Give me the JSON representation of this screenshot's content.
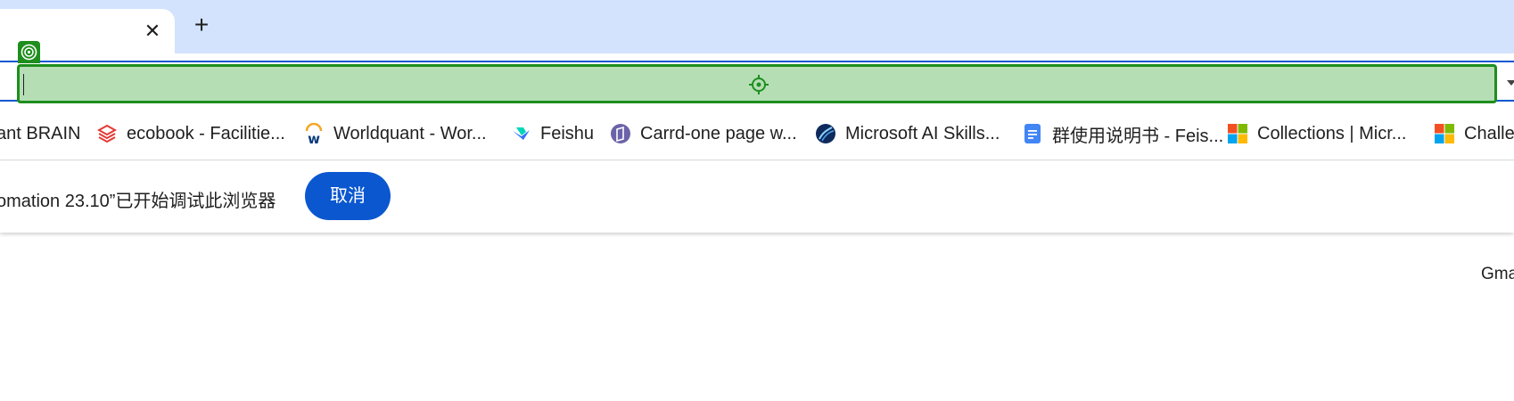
{
  "tabs": {
    "active_title": "",
    "close_glyph": "✕",
    "new_tab_glyph": "+"
  },
  "omnibox": {
    "value": "",
    "highlight_color": "#b5deb5",
    "highlight_border": "#1e8e1e",
    "focus_ring_color": "#0b57d0",
    "target_icon": "crosshair-icon",
    "marker_icon": "target-icon"
  },
  "bookmarks": [
    {
      "label": "ant BRAIN",
      "icon": "none"
    },
    {
      "label": "ecobook - Facilitie...",
      "icon": "ecobook-icon"
    },
    {
      "label": "Worldquant - Wor...",
      "icon": "workday-icon"
    },
    {
      "label": "Feishu",
      "icon": "feishu-icon"
    },
    {
      "label": "Carrd-one page w...",
      "icon": "carrd-icon"
    },
    {
      "label": "Microsoft AI Skills...",
      "icon": "globe-icon"
    },
    {
      "label": "群使用说明书 - Feis...",
      "icon": "docs-icon"
    },
    {
      "label": "Collections | Micr...",
      "icon": "microsoft-icon"
    },
    {
      "label": "Challe",
      "icon": "microsoft-icon"
    }
  ],
  "infobar": {
    "message": "omation 23.10”已开始调试此浏览器",
    "cancel_label": "取消"
  },
  "page": {
    "gmail_link": "Gma"
  },
  "colors": {
    "tabstrip": "#d3e3fd",
    "primary": "#0b57d0"
  }
}
